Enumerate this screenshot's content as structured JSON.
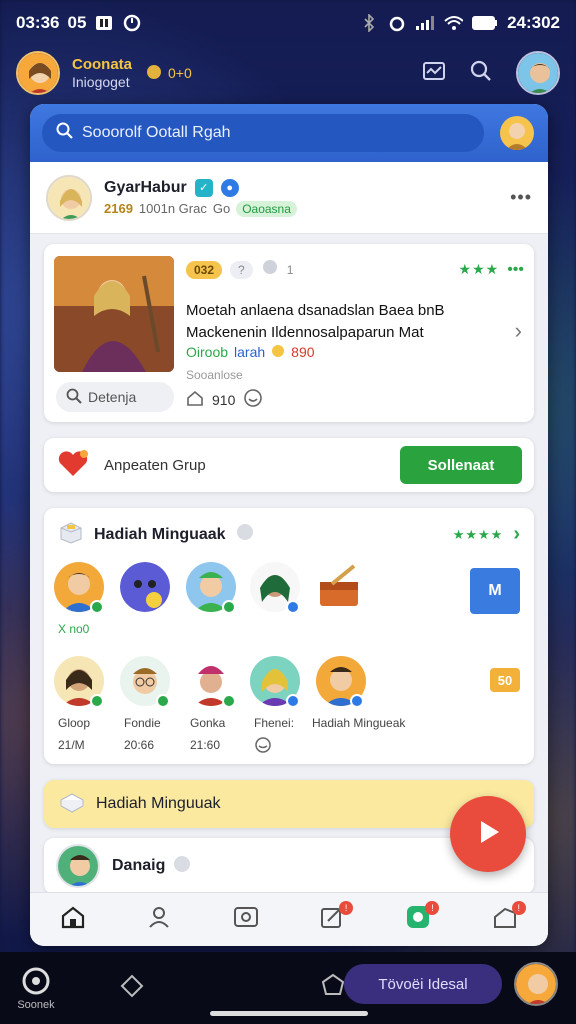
{
  "status_bar": {
    "time": "03:36",
    "extra": "05",
    "battery_text": "24:302"
  },
  "header": {
    "name": "Coonata",
    "subtitle": "Iniogoget",
    "coins": "0+0"
  },
  "search": {
    "text": "Sooorolf Ootall Rgah"
  },
  "profile": {
    "name": "GyarHabur",
    "level": "2169",
    "meta": "1001n Grac",
    "meta2": "Go",
    "pill": "Oaoasna"
  },
  "feature": {
    "tag1": "032",
    "tag2": "?",
    "tag3": "1",
    "stars": "★★★",
    "text_line1": "Moetah anlaena dsanadslan Baea bnB",
    "text_line2": "Mackenenin Ildennosalpaparun Mat",
    "price_green": "Oiroob",
    "price_blue": "larah",
    "price_red": "890",
    "subtitle": "Sooanlose",
    "search_text": "Detenja",
    "stat": "910"
  },
  "group": {
    "label": "Anpeaten Grup",
    "button": "Sollenaat"
  },
  "reward": {
    "title": "Hadiah Minguaak",
    "stars": "★★★★",
    "row1_label": "X no0",
    "m_tile": "M",
    "o_tile": "50",
    "row2": [
      {
        "name": "Gloop",
        "value": "21/M"
      },
      {
        "name": "Fondie",
        "value": "20:66"
      },
      {
        "name": "Gonka",
        "value": "21:60"
      },
      {
        "name": "Fhenei:",
        "value": ""
      },
      {
        "name": "Hadiah Mingueak",
        "value": ""
      }
    ]
  },
  "banner": {
    "text": "Hadiah Minguuak"
  },
  "bottom_card": {
    "name": "Danaig"
  },
  "system": {
    "left_label": "Soonek",
    "pill": "Tövoëi Idesal"
  },
  "colors": {
    "accent_blue": "#3f78e0",
    "green": "#2aa33f",
    "red": "#e94b3c",
    "gold": "#f4c542"
  }
}
